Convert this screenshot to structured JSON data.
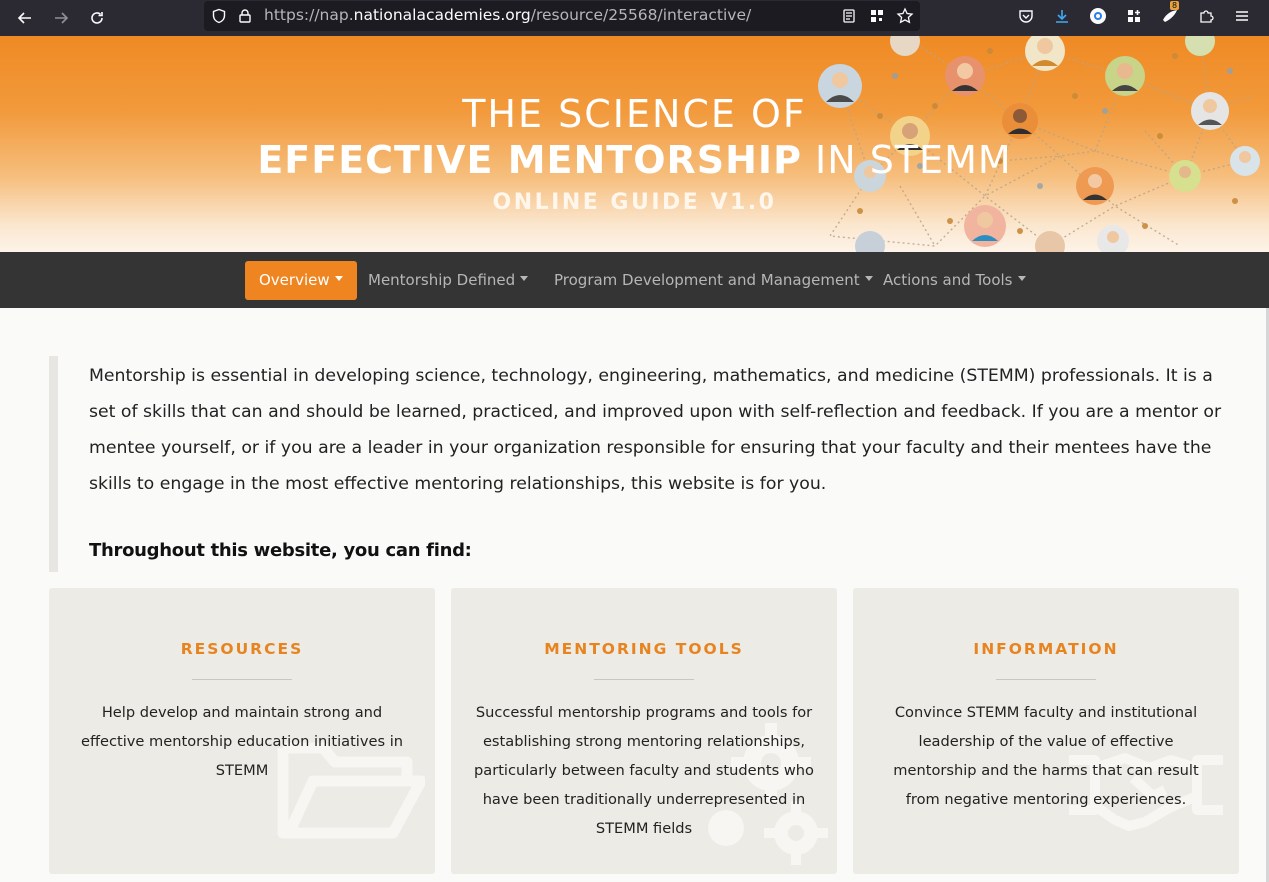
{
  "browser": {
    "url_scheme": "https://nap.",
    "url_host": "nationalacademies.org",
    "url_path": "/resource/25568/interactive/",
    "badge_count": "8"
  },
  "hero": {
    "line1": "THE SCIENCE OF",
    "line2_bold": "EFFECTIVE MENTORSHIP",
    "line2_rest": " IN STEMM",
    "line3": "ONLINE GUIDE V1.0"
  },
  "nav": {
    "items": [
      {
        "label": "Overview",
        "active": true
      },
      {
        "label": "Mentorship Defined",
        "active": false
      },
      {
        "label": "Program Development and Management",
        "active": false
      },
      {
        "label": "Actions and Tools",
        "active": false
      }
    ]
  },
  "content": {
    "intro": "Mentorship is essential in developing science, technology, engineering, mathematics, and medicine (STEMM) professionals. It is a set of skills that can and should be learned, practiced, and improved upon with self-reflection and feedback. If you are a mentor or mentee yourself, or if you are a leader in your organization responsible for ensuring that your faculty and their mentees have the skills to engage in the most effective mentoring relationships, this website is for you.",
    "subhead": "Throughout this website, you can find:",
    "cards": [
      {
        "title": "RESOURCES",
        "text": "Help develop and maintain strong and effective mentorship education initiatives in STEMM",
        "icon": "folder-icon"
      },
      {
        "title": "MENTORING TOOLS",
        "text": "Successful mentorship programs and tools for establishing strong mentoring relationships, particularly between faculty and students who have been traditionally underrepresented in STEMM fields",
        "icon": "gears-icon"
      },
      {
        "title": "INFORMATION",
        "text": "Convince STEMM faculty and institutional leadership of the value of effective mentorship and the harms that can result from negative mentoring experiences.",
        "icon": "handshake-icon"
      }
    ]
  },
  "colors": {
    "accent": "#ef8520",
    "navbar": "#343434",
    "card_bg": "#ecebe5",
    "card_title": "#e88420"
  }
}
